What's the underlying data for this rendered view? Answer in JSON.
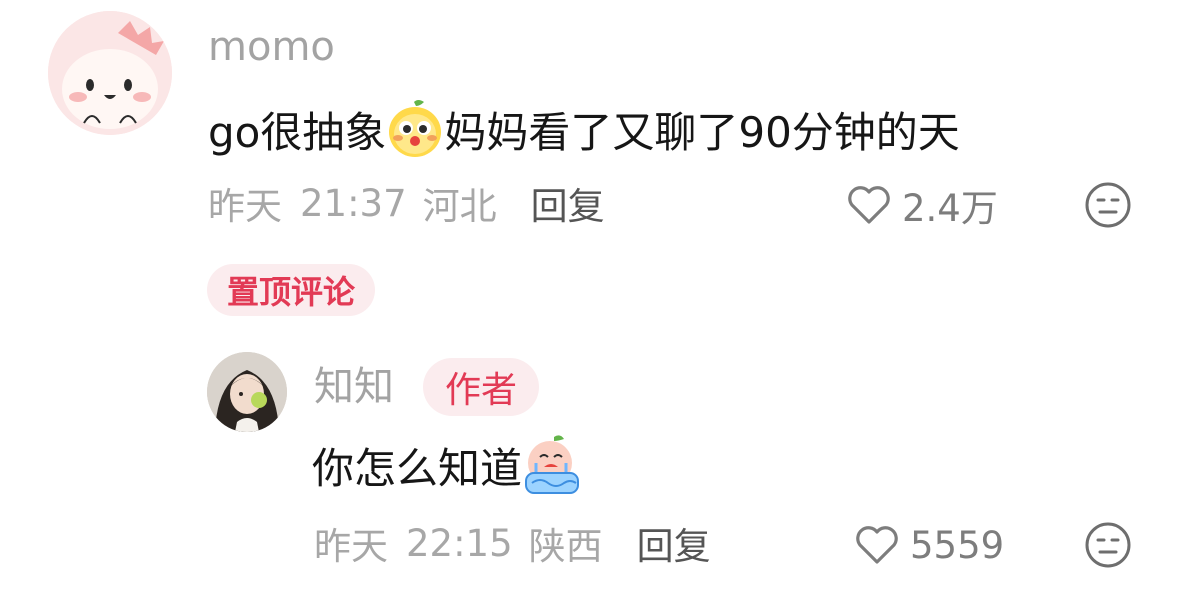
{
  "pinned_comment": {
    "username": "momo",
    "text_before_emoji": "go很抽象",
    "emoji": "lemon-face-emoji",
    "text_after_emoji": "妈妈看了又聊了90分钟的天",
    "date": "昨天",
    "time": "21:37",
    "location": "河北",
    "reply_label": "回复",
    "likes": "2.4万",
    "badge": "置顶评论"
  },
  "author_reply": {
    "username": "知知",
    "author_badge": "作者",
    "text": "你怎么知道",
    "emoji": "crying-peach-emoji",
    "date": "昨天",
    "time": "22:15",
    "location": "陕西",
    "reply_label": "回复",
    "likes": "5559"
  },
  "icons": {
    "like": "heart-outline-icon",
    "dislike": "meh-face-icon"
  },
  "colors": {
    "badge_text": "#e23a55",
    "badge_bg": "#fbecee",
    "meta_text": "#a7a7a7",
    "body_text": "#161616"
  }
}
